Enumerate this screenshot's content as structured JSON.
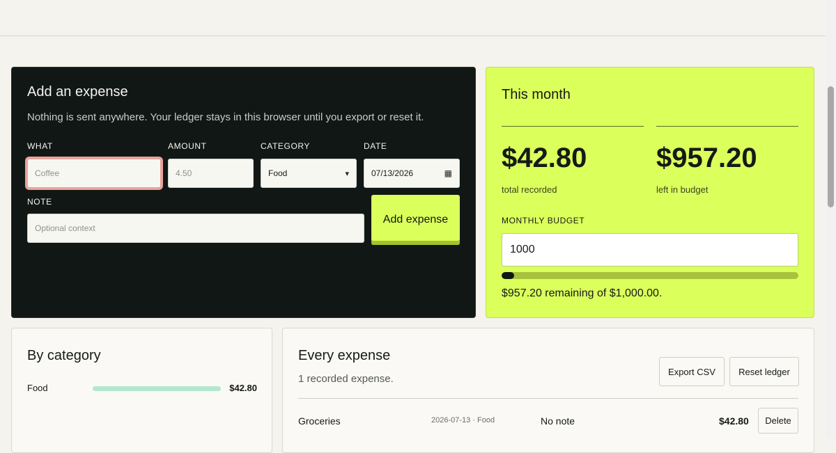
{
  "add_expense": {
    "title": "Add an expense",
    "subtitle": "Nothing is sent anywhere. Your ledger stays in this browser until you export or reset it.",
    "what_label": "What",
    "what_placeholder": "Coffee",
    "amount_label": "Amount",
    "amount_placeholder": "4.50",
    "category_label": "Category",
    "category_value": "Food",
    "date_label": "Date",
    "date_value": "07/13/2026",
    "note_label": "Note",
    "note_placeholder": "Optional context",
    "submit_label": "Add expense"
  },
  "month": {
    "title": "This month",
    "total_value": "$42.80",
    "total_caption": "total recorded",
    "left_value": "$957.20",
    "left_caption": "left in budget",
    "budget_label": "MONTHLY BUDGET",
    "budget_value": "1000",
    "budget_used_fraction": 0.0428,
    "remaining_text": "$957.20 remaining of $1,000.00."
  },
  "by_category": {
    "title": "By category",
    "items": [
      {
        "name": "Food",
        "amount": "$42.80"
      }
    ]
  },
  "expenses": {
    "title": "Every expense",
    "count_text": "1 recorded expense.",
    "export_label": "Export CSV",
    "reset_label": "Reset ledger",
    "rows": [
      {
        "name": "Groceries",
        "meta": "2026-07-13 · Food",
        "note": "No note",
        "amount": "$42.80",
        "delete_label": "Delete"
      }
    ]
  },
  "colors": {
    "accent": "#dbff5b",
    "dark": "#111714",
    "focus_ring": "#e8a39a"
  }
}
